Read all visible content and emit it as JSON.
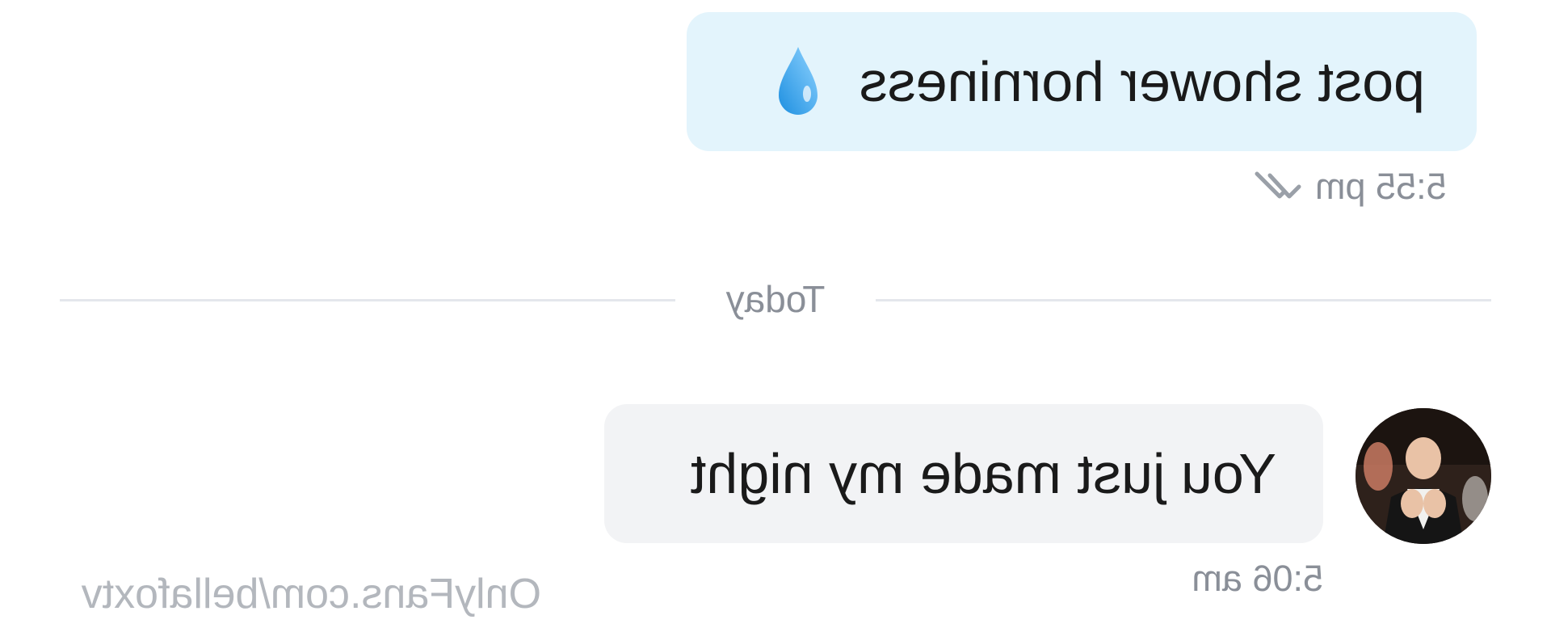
{
  "messages": [
    {
      "direction": "outgoing",
      "text": "post shower horniness",
      "emoji": "droplet-icon",
      "time": "5:55 pm",
      "status": "read"
    },
    {
      "direction": "incoming",
      "text": "You just made my night",
      "time": "5:06 am"
    }
  ],
  "divider": {
    "label": "Today"
  },
  "watermark": "OnlyFans.com/bellafoxtv",
  "colors": {
    "outgoing_bubble": "#e3f4fc",
    "incoming_bubble": "#f2f3f5",
    "timestamp": "#8a8f98",
    "divider_line": "#e4e7ec",
    "watermark": "#b3b7bd"
  }
}
